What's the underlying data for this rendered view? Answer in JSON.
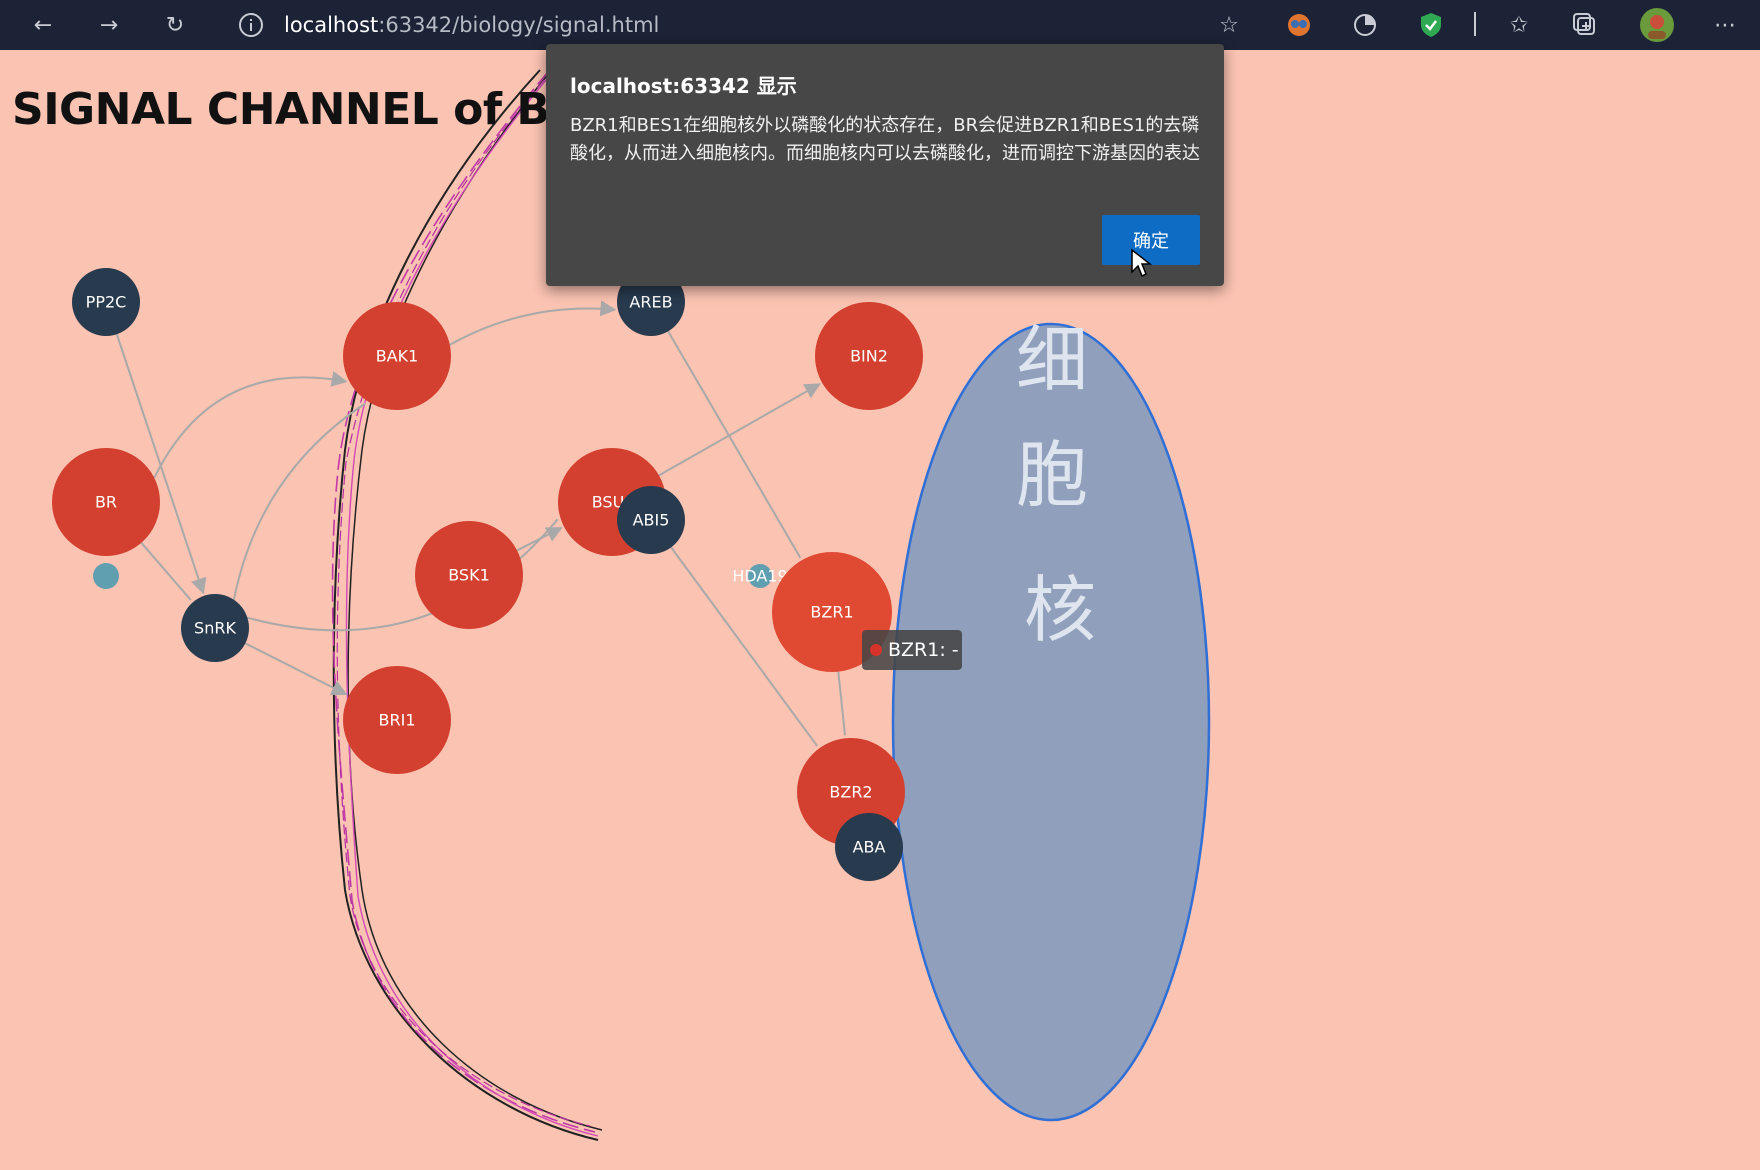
{
  "browser": {
    "url_host": "localhost",
    "url_rest": ":63342/biology/signal.html",
    "icons": [
      "back-arrow-icon",
      "forward-arrow-icon",
      "reload-icon",
      "info-icon",
      "add-favorite-icon",
      "extension-icon",
      "extension-icon",
      "shield-icon",
      "favorites-icon",
      "collections-icon",
      "profile-avatar",
      "more-icon"
    ]
  },
  "page": {
    "title": "SIGNAL CHANNEL of BR",
    "nucleus_label": "细胞核"
  },
  "diagram": {
    "nodes": [
      {
        "id": "PP2C",
        "label": "PP2C",
        "color": "#283a4d"
      },
      {
        "id": "BR",
        "label": "BR",
        "color": "#d3402f"
      },
      {
        "id": "BAK1",
        "label": "BAK1",
        "color": "#d3402f"
      },
      {
        "id": "AREB",
        "label": "AREB",
        "color": "#283a4d"
      },
      {
        "id": "BIN2",
        "label": "BIN2",
        "color": "#d3402f"
      },
      {
        "id": "BSU",
        "label": "BSU",
        "color": "#d3402f"
      },
      {
        "id": "ABI5",
        "label": "ABI5",
        "color": "#283a4d"
      },
      {
        "id": "BSK1",
        "label": "BSK1",
        "color": "#d3402f"
      },
      {
        "id": "SnRK",
        "label": "SnRK",
        "color": "#283a4d"
      },
      {
        "id": "BRI1",
        "label": "BRI1",
        "color": "#d3402f"
      },
      {
        "id": "HDA19",
        "label": "HDA19",
        "color": "#5f9fb0"
      },
      {
        "id": "BZR1",
        "label": "BZR1",
        "color": "#e04a33"
      },
      {
        "id": "BZR2",
        "label": "BZR2",
        "color": "#d3402f"
      },
      {
        "id": "ABA",
        "label": "ABA",
        "color": "#283a4d"
      }
    ],
    "edges": [
      {
        "from": "PP2C",
        "to": "SnRK",
        "arrow": true
      },
      {
        "from": "BR",
        "to": "BAK1",
        "arrow": true
      },
      {
        "from": "BR",
        "to": "SnRK",
        "arrow": false
      },
      {
        "from": "SnRK",
        "to": "BAK1",
        "arrow": false
      },
      {
        "from": "SnRK",
        "to": "BRI1",
        "arrow": true
      },
      {
        "from": "SnRK",
        "to": "BSU",
        "arrow": false
      },
      {
        "from": "BAK1",
        "to": "AREB",
        "arrow": true
      },
      {
        "from": "BSK1",
        "to": "BSU",
        "arrow": true
      },
      {
        "from": "BSU",
        "to": "BIN2",
        "arrow": true
      },
      {
        "from": "AREB",
        "to": "BZR1",
        "arrow": false
      },
      {
        "from": "ABI5",
        "to": "BZR2",
        "arrow": false
      },
      {
        "from": "BZR1",
        "to": "BZR2",
        "arrow": false
      }
    ]
  },
  "tooltip": {
    "text": "BZR1: -",
    "dot_color": "#d6332a"
  },
  "alert": {
    "title": "localhost:63342 显示",
    "message": "BZR1和BES1在细胞核外以磷酸化的状态存在，BR会促进BZR1和BES1的去磷酸化，从而进入细胞核内。而细胞核内可以去磷酸化，进而调控下游基因的表达",
    "ok_label": "确定"
  }
}
